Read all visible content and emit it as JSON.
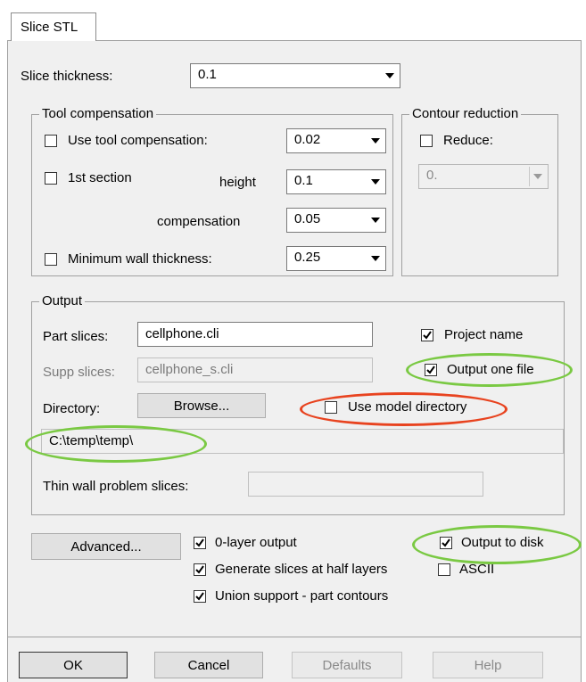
{
  "tab": {
    "label": "Slice STL"
  },
  "slice_thickness": {
    "label": "Slice thickness:",
    "value": "0.1"
  },
  "tool_compensation": {
    "title": "Tool compensation",
    "use_tool_label": "Use tool compensation:",
    "use_tool_value": "0.02",
    "first_section_label": "1st section",
    "height_label": "height",
    "height_value": "0.1",
    "compensation_label": "compensation",
    "compensation_value": "0.05",
    "min_wall_label": "Minimum wall thickness:",
    "min_wall_value": "0.25"
  },
  "contour_reduction": {
    "title": "Contour reduction",
    "reduce_label": "Reduce:",
    "reduce_value": "0."
  },
  "output": {
    "title": "Output",
    "part_slices_label": "Part slices:",
    "part_slices_value": "cellphone.cli",
    "project_name_label": "Project name",
    "supp_slices_label": "Supp slices:",
    "supp_slices_value": "cellphone_s.cli",
    "output_one_file_label": "Output one file",
    "directory_label": "Directory:",
    "browse_label": "Browse...",
    "use_model_dir_label": "Use model directory",
    "directory_path": "C:\\temp\\temp\\",
    "thin_wall_label": "Thin wall problem slices:",
    "thin_wall_value": ""
  },
  "options": {
    "advanced_label": "Advanced...",
    "zero_layer_label": "0-layer output",
    "half_layers_label": "Generate slices at half layers",
    "ascii_label": "ASCII",
    "union_support_label": "Union support - part contours",
    "output_to_disk_label": "Output to disk"
  },
  "buttons": {
    "ok": "OK",
    "cancel": "Cancel",
    "defaults": "Defaults",
    "help": "Help"
  },
  "highlight_colors": {
    "green": "#7ac943",
    "red": "#e8431f"
  }
}
